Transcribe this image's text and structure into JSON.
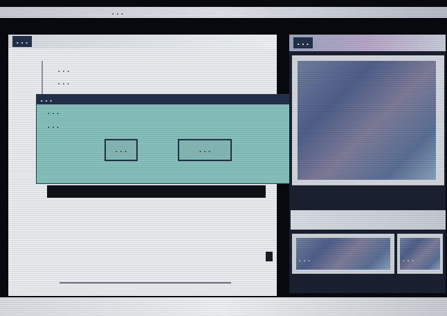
{
  "window": {
    "title": "..."
  },
  "left_panel": {
    "header": "...",
    "items": [
      "...",
      "..."
    ],
    "footer_strip": ""
  },
  "dialog": {
    "title": "...",
    "subtitle": "...",
    "message": "...",
    "ok_label": "...",
    "cancel_label": "..."
  },
  "right_panel": {
    "header": "...",
    "thumb_left_label": "...",
    "thumb_right_label": "..."
  },
  "status_bar": {
    "text": ""
  },
  "colors": {
    "background": "#08090f",
    "dialog": "#86c0bb",
    "header": "#23304a",
    "panel": "#e8ecee"
  }
}
